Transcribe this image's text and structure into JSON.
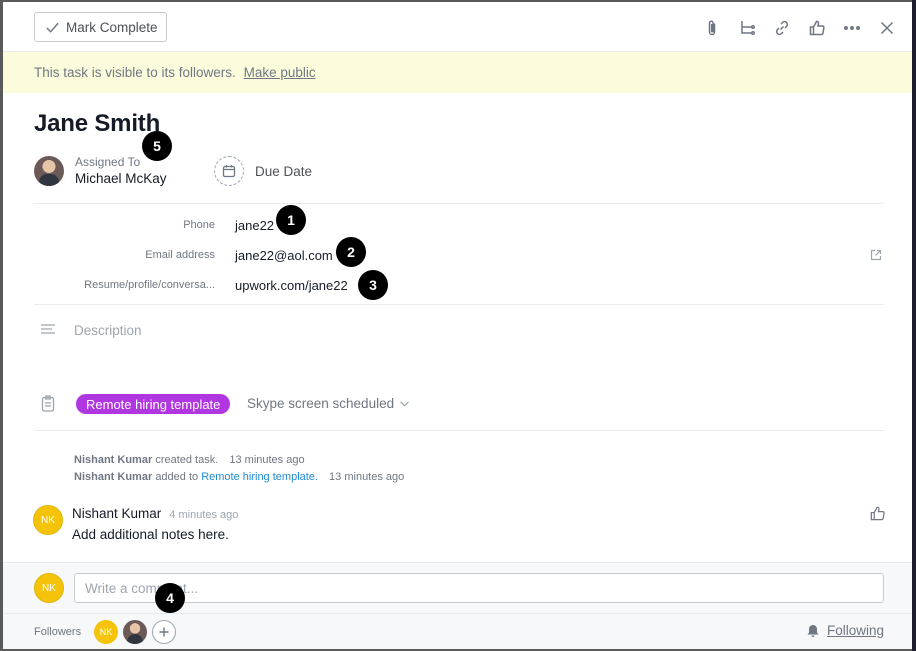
{
  "toolbar": {
    "mark_complete_label": "Mark Complete"
  },
  "privacy": {
    "text": "This task is visible to its followers.",
    "link": "Make public"
  },
  "task": {
    "title": "Jane Smith",
    "assignee_label": "Assigned To",
    "assignee_name": "Michael McKay",
    "due_label": "Due Date"
  },
  "fields": [
    {
      "label": "Phone",
      "value": "jane22"
    },
    {
      "label": "Email address",
      "value": "jane22@aol.com"
    },
    {
      "label": "Resume/profile/conversa...",
      "value": "upwork.com/jane22"
    }
  ],
  "description": {
    "placeholder": "Description"
  },
  "template": {
    "tag": "Remote hiring template",
    "section": "Skype screen scheduled",
    "tag_color": "#b036e0"
  },
  "activity": [
    {
      "user": "Nishant Kumar",
      "action": "created task.",
      "link": "",
      "time": "13 minutes ago"
    },
    {
      "user": "Nishant Kumar",
      "action": "added to",
      "link": "Remote hiring template.",
      "time": "13 minutes ago"
    }
  ],
  "comment": {
    "initials": "NK",
    "author": "Nishant Kumar",
    "time": "4 minutes ago",
    "body": "Add additional notes here."
  },
  "composer": {
    "initials": "NK",
    "placeholder": "Write a comment..."
  },
  "followers": {
    "label": "Followers",
    "initials": "NK",
    "following_label": "Following"
  },
  "markers": [
    "1",
    "2",
    "3",
    "4",
    "5"
  ],
  "colors": {
    "avatar_yellow": "#f6c30b",
    "link_blue": "#1f8dd6",
    "privacy_bg": "#fcfcdc"
  }
}
